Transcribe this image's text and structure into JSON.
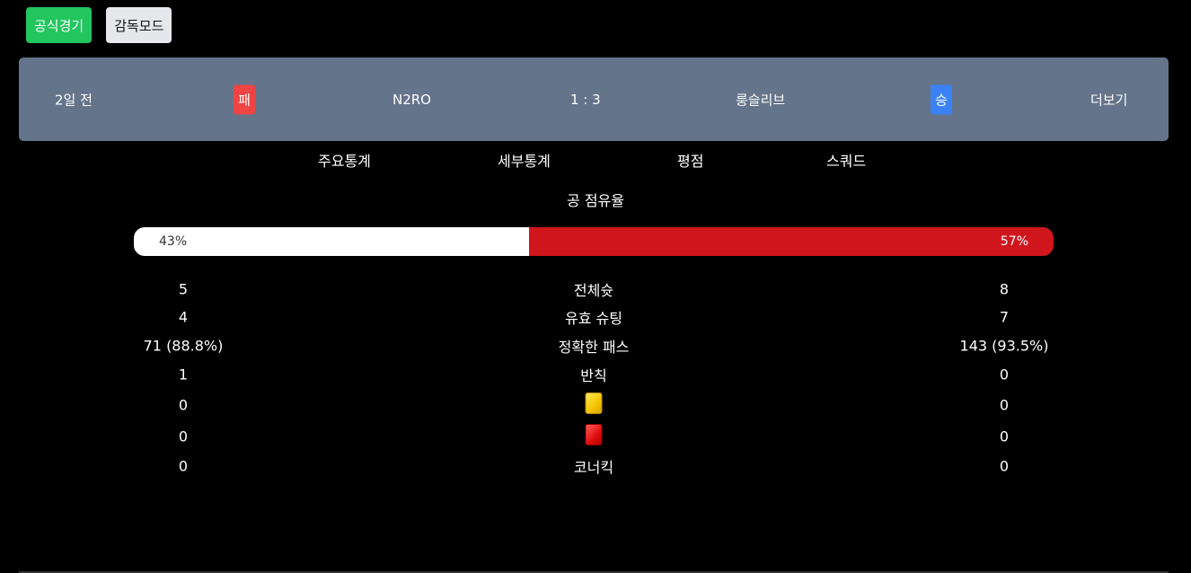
{
  "modes": {
    "official_label": "공식경기",
    "manager_label": "감독모드"
  },
  "match": {
    "time_ago": "2일 전",
    "home_result": "패",
    "home_team": "N2RO",
    "score": "1 : 3",
    "away_team": "룽슬리브",
    "away_result": "승",
    "more_label": "더보기",
    "colors": {
      "loss": "#ef4444",
      "win": "#3b82f6",
      "card_bg": "#64748b"
    }
  },
  "tabs": [
    "주요통계",
    "세부통계",
    "평점",
    "스쿼드"
  ],
  "possession": {
    "title": "공 점유율",
    "home_label": "43%",
    "away_label": "57%",
    "home_value": 43,
    "away_value": 57,
    "colors": {
      "home": "#ffffff",
      "away": "#d0161d"
    }
  },
  "stats": [
    {
      "label": "전체슛",
      "icon": "",
      "home": "5",
      "away": "8"
    },
    {
      "label": "유효 슈팅",
      "icon": "",
      "home": "4",
      "away": "7"
    },
    {
      "label": "정확한 패스",
      "icon": "",
      "home": "71 (88.8%)",
      "away": "143 (93.5%)"
    },
    {
      "label": "반칙",
      "icon": "",
      "home": "1",
      "away": "0"
    },
    {
      "label": "",
      "icon": "yellow-card-icon",
      "home": "0",
      "away": "0"
    },
    {
      "label": "",
      "icon": "red-card-icon",
      "home": "0",
      "away": "0"
    },
    {
      "label": "코너킥",
      "icon": "",
      "home": "0",
      "away": "0"
    }
  ]
}
